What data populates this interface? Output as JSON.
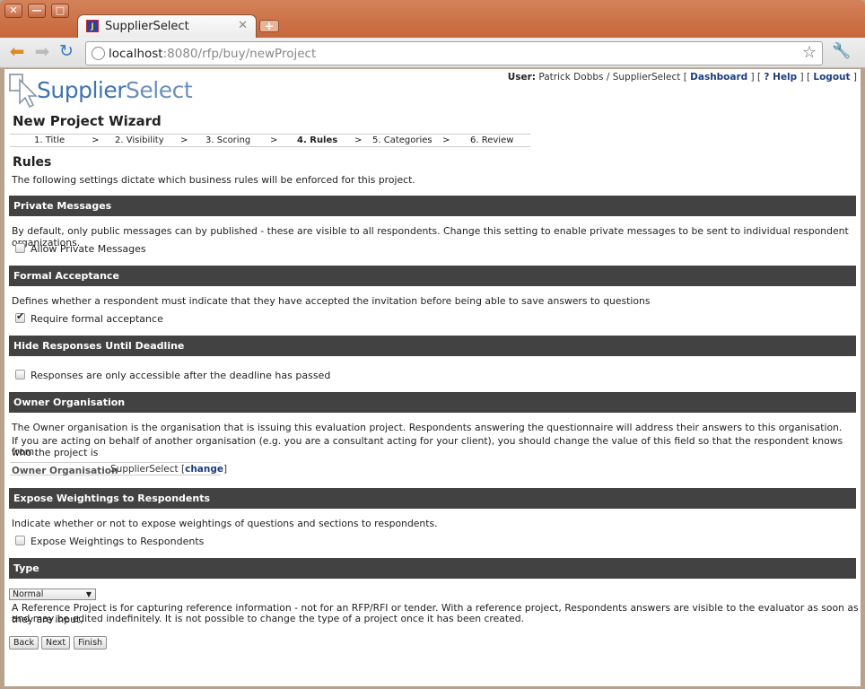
{
  "browser": {
    "tab_title": "SupplierSelect",
    "url_host": "localhost",
    "url_rest": ":8080/rfp/buy/newProject"
  },
  "brand": {
    "logo_part1": "Supplier",
    "logo_part2": "Select"
  },
  "userbar": {
    "user_label": "User:",
    "user_text": "Patrick Dobbs / SupplierSelect [",
    "dashboard": "Dashboard",
    "sep1": "] [",
    "help": "? Help",
    "sep2": "] [",
    "logout": "Logout",
    "end": "]"
  },
  "wizard": {
    "title": "New Project Wizard",
    "steps": [
      "1. Title",
      "2. Visibility",
      "3. Scoring",
      "4. Rules",
      "5. Categories",
      "6. Review"
    ],
    "separator": ">",
    "current_step": "4. Rules"
  },
  "rules": {
    "heading": "Rules",
    "intro": "The following settings dictate which business rules will be enforced for this project."
  },
  "sections": {
    "private_messages": {
      "title": "Private Messages",
      "desc": "By default, only public messages can by published - these are visible to all respondents. Change this setting to enable private messages to be sent to individual respondent organizations.",
      "checkbox_label": "Allow Private Messages",
      "checked": false
    },
    "formal_acceptance": {
      "title": "Formal Acceptance",
      "desc": "Defines whether a respondent must indicate that they have accepted the invitation before being able to save answers to questions",
      "checkbox_label": "Require formal acceptance",
      "checked": true
    },
    "hide_responses": {
      "title": "Hide Responses Until Deadline",
      "checkbox_label": "Responses are only accessible after the deadline has passed",
      "checked": false
    },
    "owner_org": {
      "title": "Owner Organisation",
      "desc1": "The Owner organisation is the organisation that is issuing this evaluation project. Respondents answering the questionnaire will address their answers to this organisation.",
      "desc2": "If you are acting on behalf of another organisation (e.g. you are a consultant acting for your client), you should change the value of this field so that the respondent knows who the project is",
      "desc2b": "from.",
      "field_label": "Owner Organisation",
      "field_value": "SupplierSelect [",
      "change_link": "change",
      "field_end": "]"
    },
    "expose_weightings": {
      "title": "Expose Weightings to Respondents",
      "desc": "Indicate whether or not to expose weightings of questions and sections to respondents.",
      "checkbox_label": "Expose Weightings to Respondents",
      "checked": false
    },
    "type": {
      "title": "Type",
      "selected": "Normal",
      "desc1": "A Reference Project is for capturing reference information - not for an RFP/RFI or tender. With a reference project, Respondents answers are visible to the evaluator as soon as they are input,",
      "desc2": "and may be edited indefinitely. It is not possible to change the type of a project once it has been created."
    }
  },
  "buttons": {
    "back": "Back",
    "next": "Next",
    "finish": "Finish"
  }
}
